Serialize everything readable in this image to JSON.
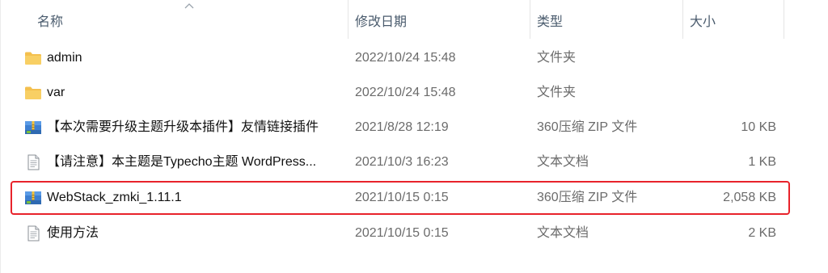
{
  "columns": {
    "name": "名称",
    "modified": "修改日期",
    "type": "类型",
    "size": "大小"
  },
  "sort": {
    "column": "name",
    "direction": "ascending",
    "icon": "chevron-up-icon"
  },
  "files": [
    {
      "name": "admin",
      "modified": "2022/10/24 15:48",
      "type": "文件夹",
      "size": "",
      "icon": "folder-icon"
    },
    {
      "name": "var",
      "modified": "2022/10/24 15:48",
      "type": "文件夹",
      "size": "",
      "icon": "folder-icon"
    },
    {
      "name": "【本次需要升级主题升级本插件】友情链接插件",
      "modified": "2021/8/28 12:19",
      "type": "360压缩 ZIP 文件",
      "size": "10 KB",
      "icon": "zip-archive-icon"
    },
    {
      "name": "【请注意】本主题是Typecho主题 WordPress...",
      "modified": "2021/10/3 16:23",
      "type": "文本文档",
      "size": "1 KB",
      "icon": "text-document-icon"
    },
    {
      "name": "WebStack_zmki_1.11.1",
      "modified": "2021/10/15 0:15",
      "type": "360压缩 ZIP 文件",
      "size": "2,058 KB",
      "icon": "zip-archive-icon"
    },
    {
      "name": "使用方法",
      "modified": "2021/10/15 0:15",
      "type": "文本文档",
      "size": "2 KB",
      "icon": "text-document-icon"
    }
  ],
  "highlight": {
    "row_index": 4,
    "color": "#e8232b"
  },
  "colors": {
    "folder": "#f4c04e",
    "header_text": "#4a5b6d",
    "secondary_text": "#6b6b6b"
  }
}
